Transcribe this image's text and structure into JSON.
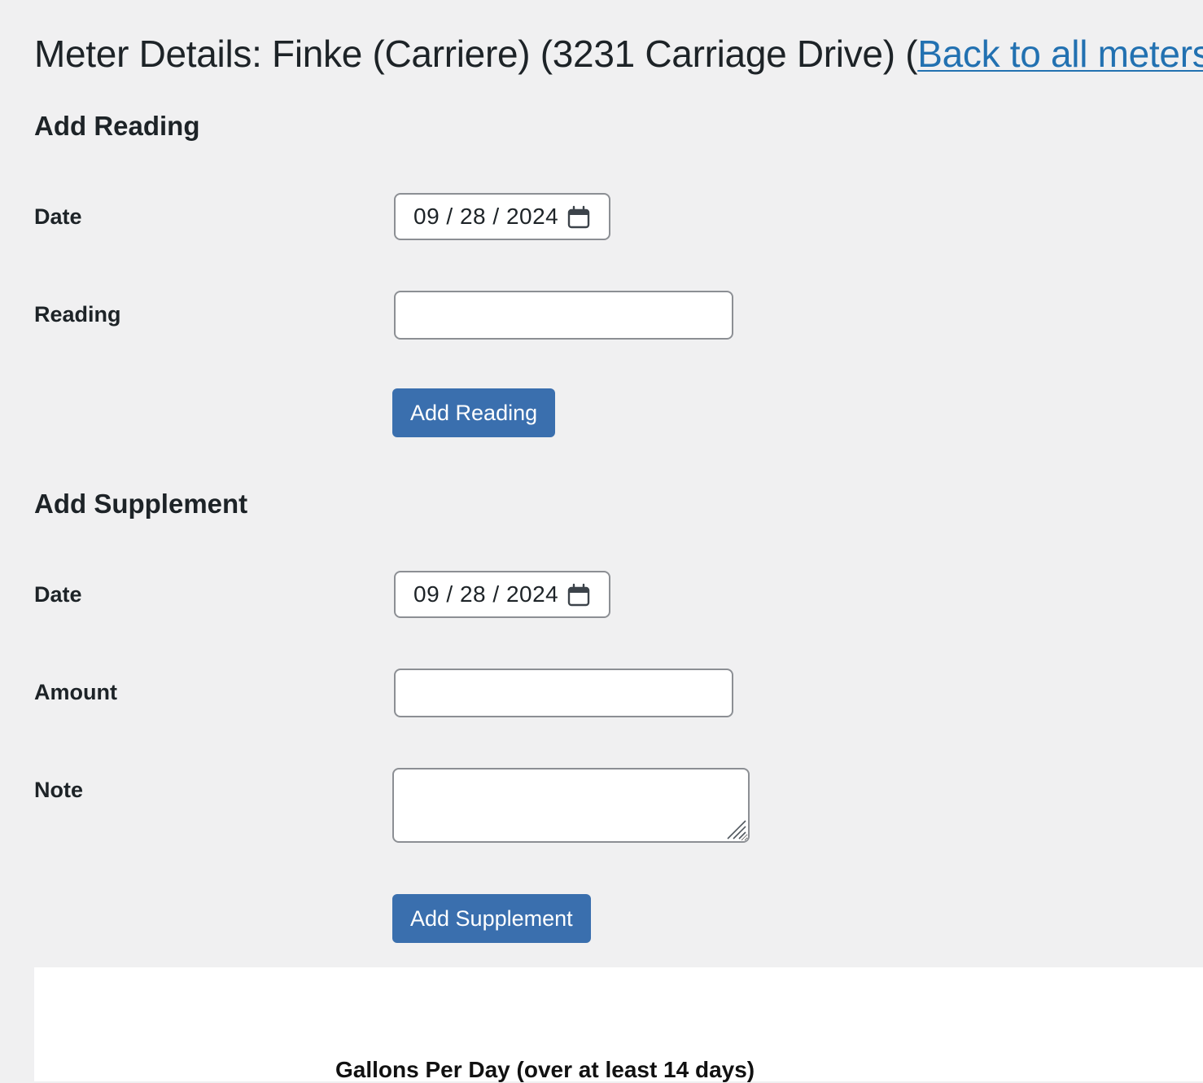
{
  "header": {
    "title_prefix": "Meter Details: Finke (Carriere) (3231 Carriage Drive) (",
    "back_link": "Back to all meters",
    "title_suffix": ")"
  },
  "add_reading": {
    "heading": "Add Reading",
    "date_label": "Date",
    "date_value": "09 / 28 / 2024",
    "reading_label": "Reading",
    "reading_value": "",
    "submit_label": "Add Reading"
  },
  "add_supplement": {
    "heading": "Add Supplement",
    "date_label": "Date",
    "date_value": "09 / 28 / 2024",
    "amount_label": "Amount",
    "amount_value": "",
    "note_label": "Note",
    "note_value": "",
    "submit_label": "Add Supplement"
  },
  "chart": {
    "title": "Gallons Per Day (over at least 14 days)"
  },
  "colors": {
    "background": "#f0f0f1",
    "link": "#2271b1",
    "button": "#3a6fae",
    "panel": "#ffffff"
  },
  "icons": {
    "date_picker": "calendar-icon",
    "textarea_resize": "resize-grip-icon"
  }
}
